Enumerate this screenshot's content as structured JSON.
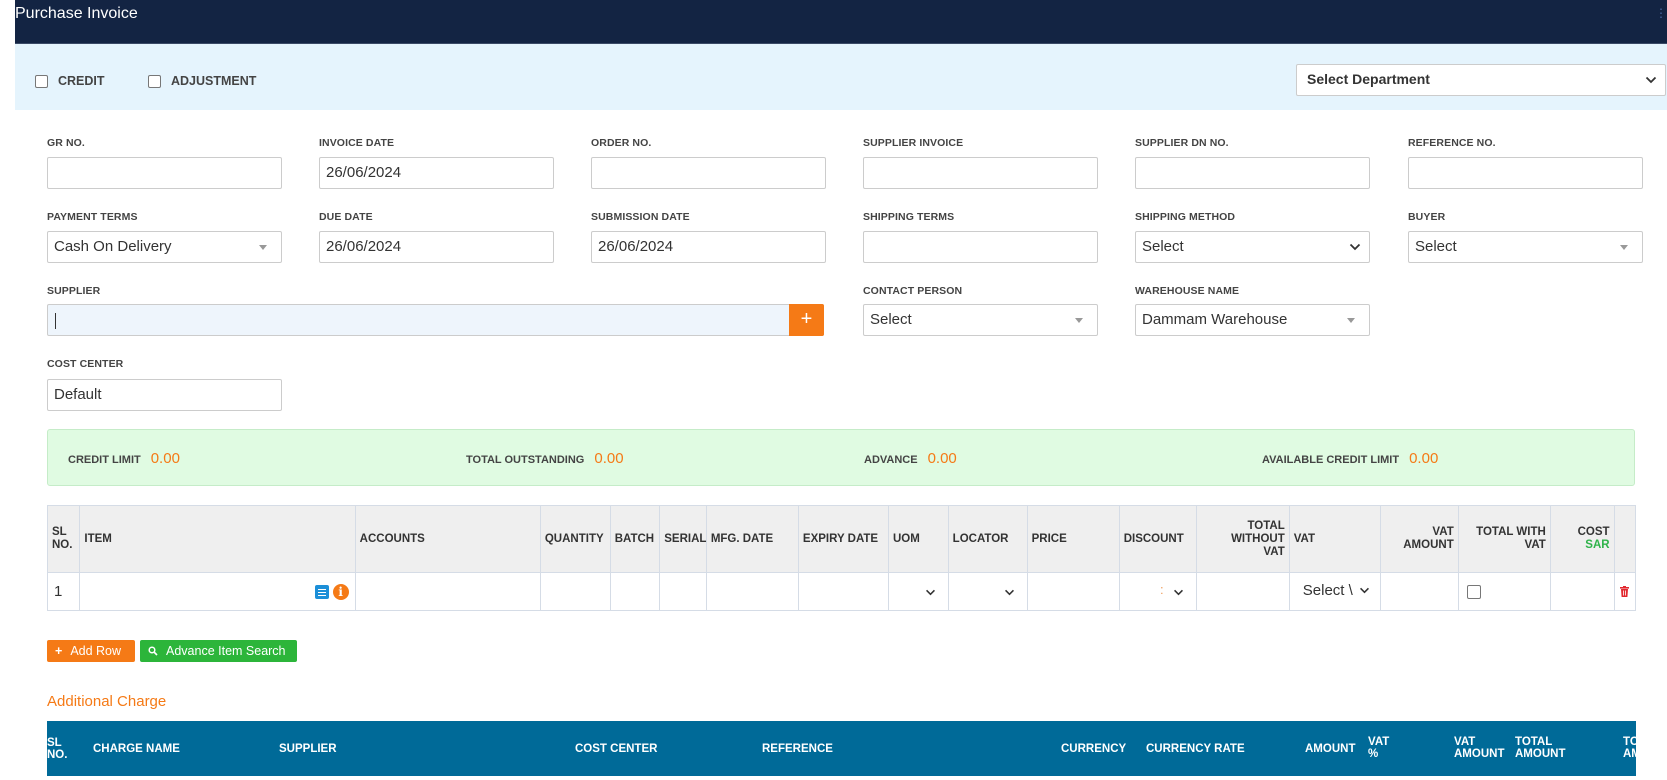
{
  "window": {
    "title": "Purchase Invoice"
  },
  "options": {
    "credit_label": "CREDIT",
    "credit_checked": false,
    "adjustment_label": "ADJUSTMENT",
    "adjustment_checked": false,
    "department_select": "Select Department"
  },
  "form": {
    "gr_no": {
      "label": "GR NO.",
      "value": ""
    },
    "invoice_date": {
      "label": "INVOICE DATE",
      "value": "26/06/2024"
    },
    "order_no": {
      "label": "ORDER NO.",
      "value": ""
    },
    "supplier_invoice": {
      "label": "SUPPLIER INVOICE",
      "value": ""
    },
    "supplier_dn_no": {
      "label": "SUPPLIER DN NO.",
      "value": ""
    },
    "reference_no": {
      "label": "REFERENCE NO.",
      "value": ""
    },
    "payment_terms": {
      "label": "PAYMENT TERMS",
      "value": "Cash On Delivery"
    },
    "due_date": {
      "label": "DUE DATE",
      "value": "26/06/2024"
    },
    "submission_date": {
      "label": "SUBMISSION DATE",
      "value": "26/06/2024"
    },
    "shipping_terms": {
      "label": "SHIPPING TERMS",
      "value": ""
    },
    "shipping_method": {
      "label": "SHIPPING METHOD",
      "value": "Select"
    },
    "buyer": {
      "label": "BUYER",
      "value": "Select"
    },
    "supplier": {
      "label": "SUPPLIER",
      "value": "",
      "add_label": "+"
    },
    "contact_person": {
      "label": "CONTACT PERSON",
      "value": "Select"
    },
    "warehouse_name": {
      "label": "WAREHOUSE NAME",
      "value": "Dammam Warehouse"
    },
    "cost_center": {
      "label": "COST CENTER",
      "value": "Default"
    }
  },
  "credit_summary": {
    "credit_limit": {
      "label": "CREDIT LIMIT",
      "value": "0.00"
    },
    "total_outstanding": {
      "label": "TOTAL OUTSTANDING",
      "value": "0.00"
    },
    "advance": {
      "label": "ADVANCE",
      "value": "0.00"
    },
    "available_credit_limit": {
      "label": "AVAILABLE CREDIT LIMIT",
      "value": "0.00"
    }
  },
  "items_table": {
    "headers": {
      "sl_no_1": "SL",
      "sl_no_2": "NO.",
      "item": "ITEM",
      "accounts": "ACCOUNTS",
      "quantity": "QUANTITY",
      "batch": "BATCH",
      "serial": "SERIAL",
      "mfg_date": "MFG. DATE",
      "expiry_date": "EXPIRY DATE",
      "uom": "UOM",
      "locator": "LOCATOR",
      "price": "PRICE",
      "discount": "DISCOUNT",
      "total_without_vat_1": "TOTAL",
      "total_without_vat_2": "WITHOUT",
      "total_without_vat_3": "VAT",
      "vat": "VAT",
      "vat_amount_1": "VAT",
      "vat_amount_2": "AMOUNT",
      "total_with_vat_1": "TOTAL WITH",
      "total_with_vat_2": "VAT",
      "cost_1": "COST",
      "cost_2": "SAR"
    },
    "rows": [
      {
        "sl_no": "1",
        "item": "",
        "accounts": "",
        "quantity": "",
        "batch": "",
        "serial": "",
        "mfg_date": "",
        "expiry_date": "",
        "uom": "",
        "locator": "",
        "price": "",
        "discount": ":",
        "total_without_vat": "",
        "vat": "Select \\",
        "vat_amount": "",
        "total_with_vat_checked": false,
        "cost": ""
      }
    ]
  },
  "actions": {
    "add_row_icon": "+",
    "add_row": "Add Row",
    "advance_search_icon": "search-icon",
    "advance_search": "Advance Item Search"
  },
  "additional_charge": {
    "title": "Additional Charge",
    "headers": {
      "sl_no_1": "SL",
      "sl_no_2": "NO.",
      "charge_name": "CHARGE NAME",
      "supplier": "SUPPLIER",
      "cost_center": "COST CENTER",
      "reference": "REFERENCE",
      "currency": "CURRENCY",
      "currency_rate": "CURRENCY RATE",
      "amount": "AMOUNT",
      "vat_pct_1": "VAT",
      "vat_pct_2": "%",
      "vat_amount_1": "VAT",
      "vat_amount_2": "AMOUNT",
      "total_amount_1": "TOTAL",
      "total_amount_2": "AMOUNT",
      "total_amount_sar_1": "TOTAL",
      "total_amount_sar_2": "AMOUNT(SAR)"
    }
  },
  "colors": {
    "header_bg": "#132443",
    "options_bg": "#e5f4fd",
    "accent_orange": "#f57a16",
    "accent_green": "#2cb53a",
    "credit_bg": "#e0fbe2",
    "charge_header_bg": "#006a98"
  }
}
